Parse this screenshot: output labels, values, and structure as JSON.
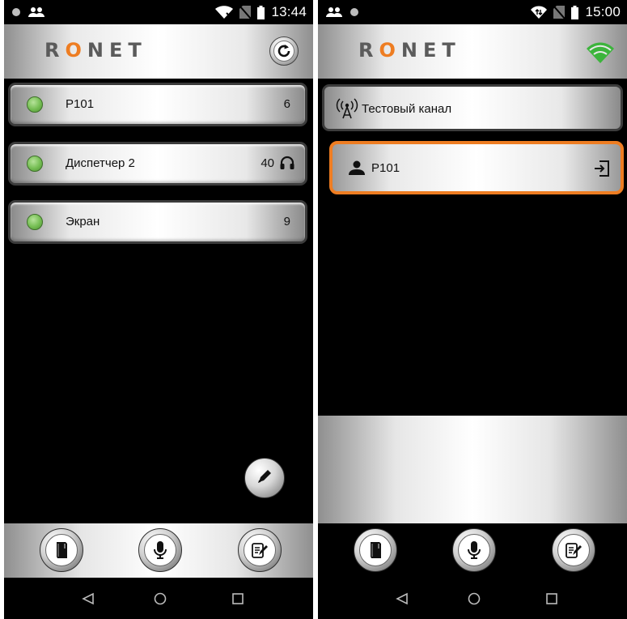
{
  "colors": {
    "accent": "#ee7d22",
    "led_green": "#74bd52",
    "selection_border": "#ee7d22",
    "wifi_green": "#3cb43c"
  },
  "left_screen": {
    "status_bar": {
      "time": "13:44",
      "icons": [
        "dot-icon",
        "people-icon",
        "wifi-x-icon",
        "no-sim-icon",
        "battery-icon"
      ]
    },
    "header": {
      "logo_prefix": "R",
      "logo_accent": "O",
      "logo_suffix": "NET",
      "action_icon": "refresh-icon"
    },
    "items": [
      {
        "label": "P101",
        "count": "6",
        "status": "online"
      },
      {
        "label": "Диспетчер 2",
        "count": "40",
        "status": "online",
        "icon": "headset-icon"
      },
      {
        "label": "Экран",
        "count": "9",
        "status": "online"
      }
    ],
    "fab_icon": "pencil-icon",
    "toolbar_icons": [
      "book-icon",
      "microphone-icon",
      "notes-icon"
    ]
  },
  "right_screen": {
    "status_bar": {
      "time": "15:00",
      "icons": [
        "people-icon",
        "dot-icon",
        "wifi-arrows-icon",
        "no-sim-icon",
        "battery-icon"
      ]
    },
    "header": {
      "logo_prefix": "R",
      "logo_accent": "O",
      "logo_suffix": "NET",
      "status_icon": "wifi-signal-icon"
    },
    "channel": {
      "label": "Тестовый канал",
      "icon": "antenna-icon"
    },
    "user": {
      "label": "P101",
      "icon": "person-icon",
      "action_icon": "login-icon",
      "selected": true
    },
    "toolbar_icons": [
      "book-icon",
      "microphone-icon",
      "notes-icon"
    ]
  },
  "navbar": {
    "icons": [
      "back-icon",
      "home-icon",
      "recents-icon"
    ]
  }
}
